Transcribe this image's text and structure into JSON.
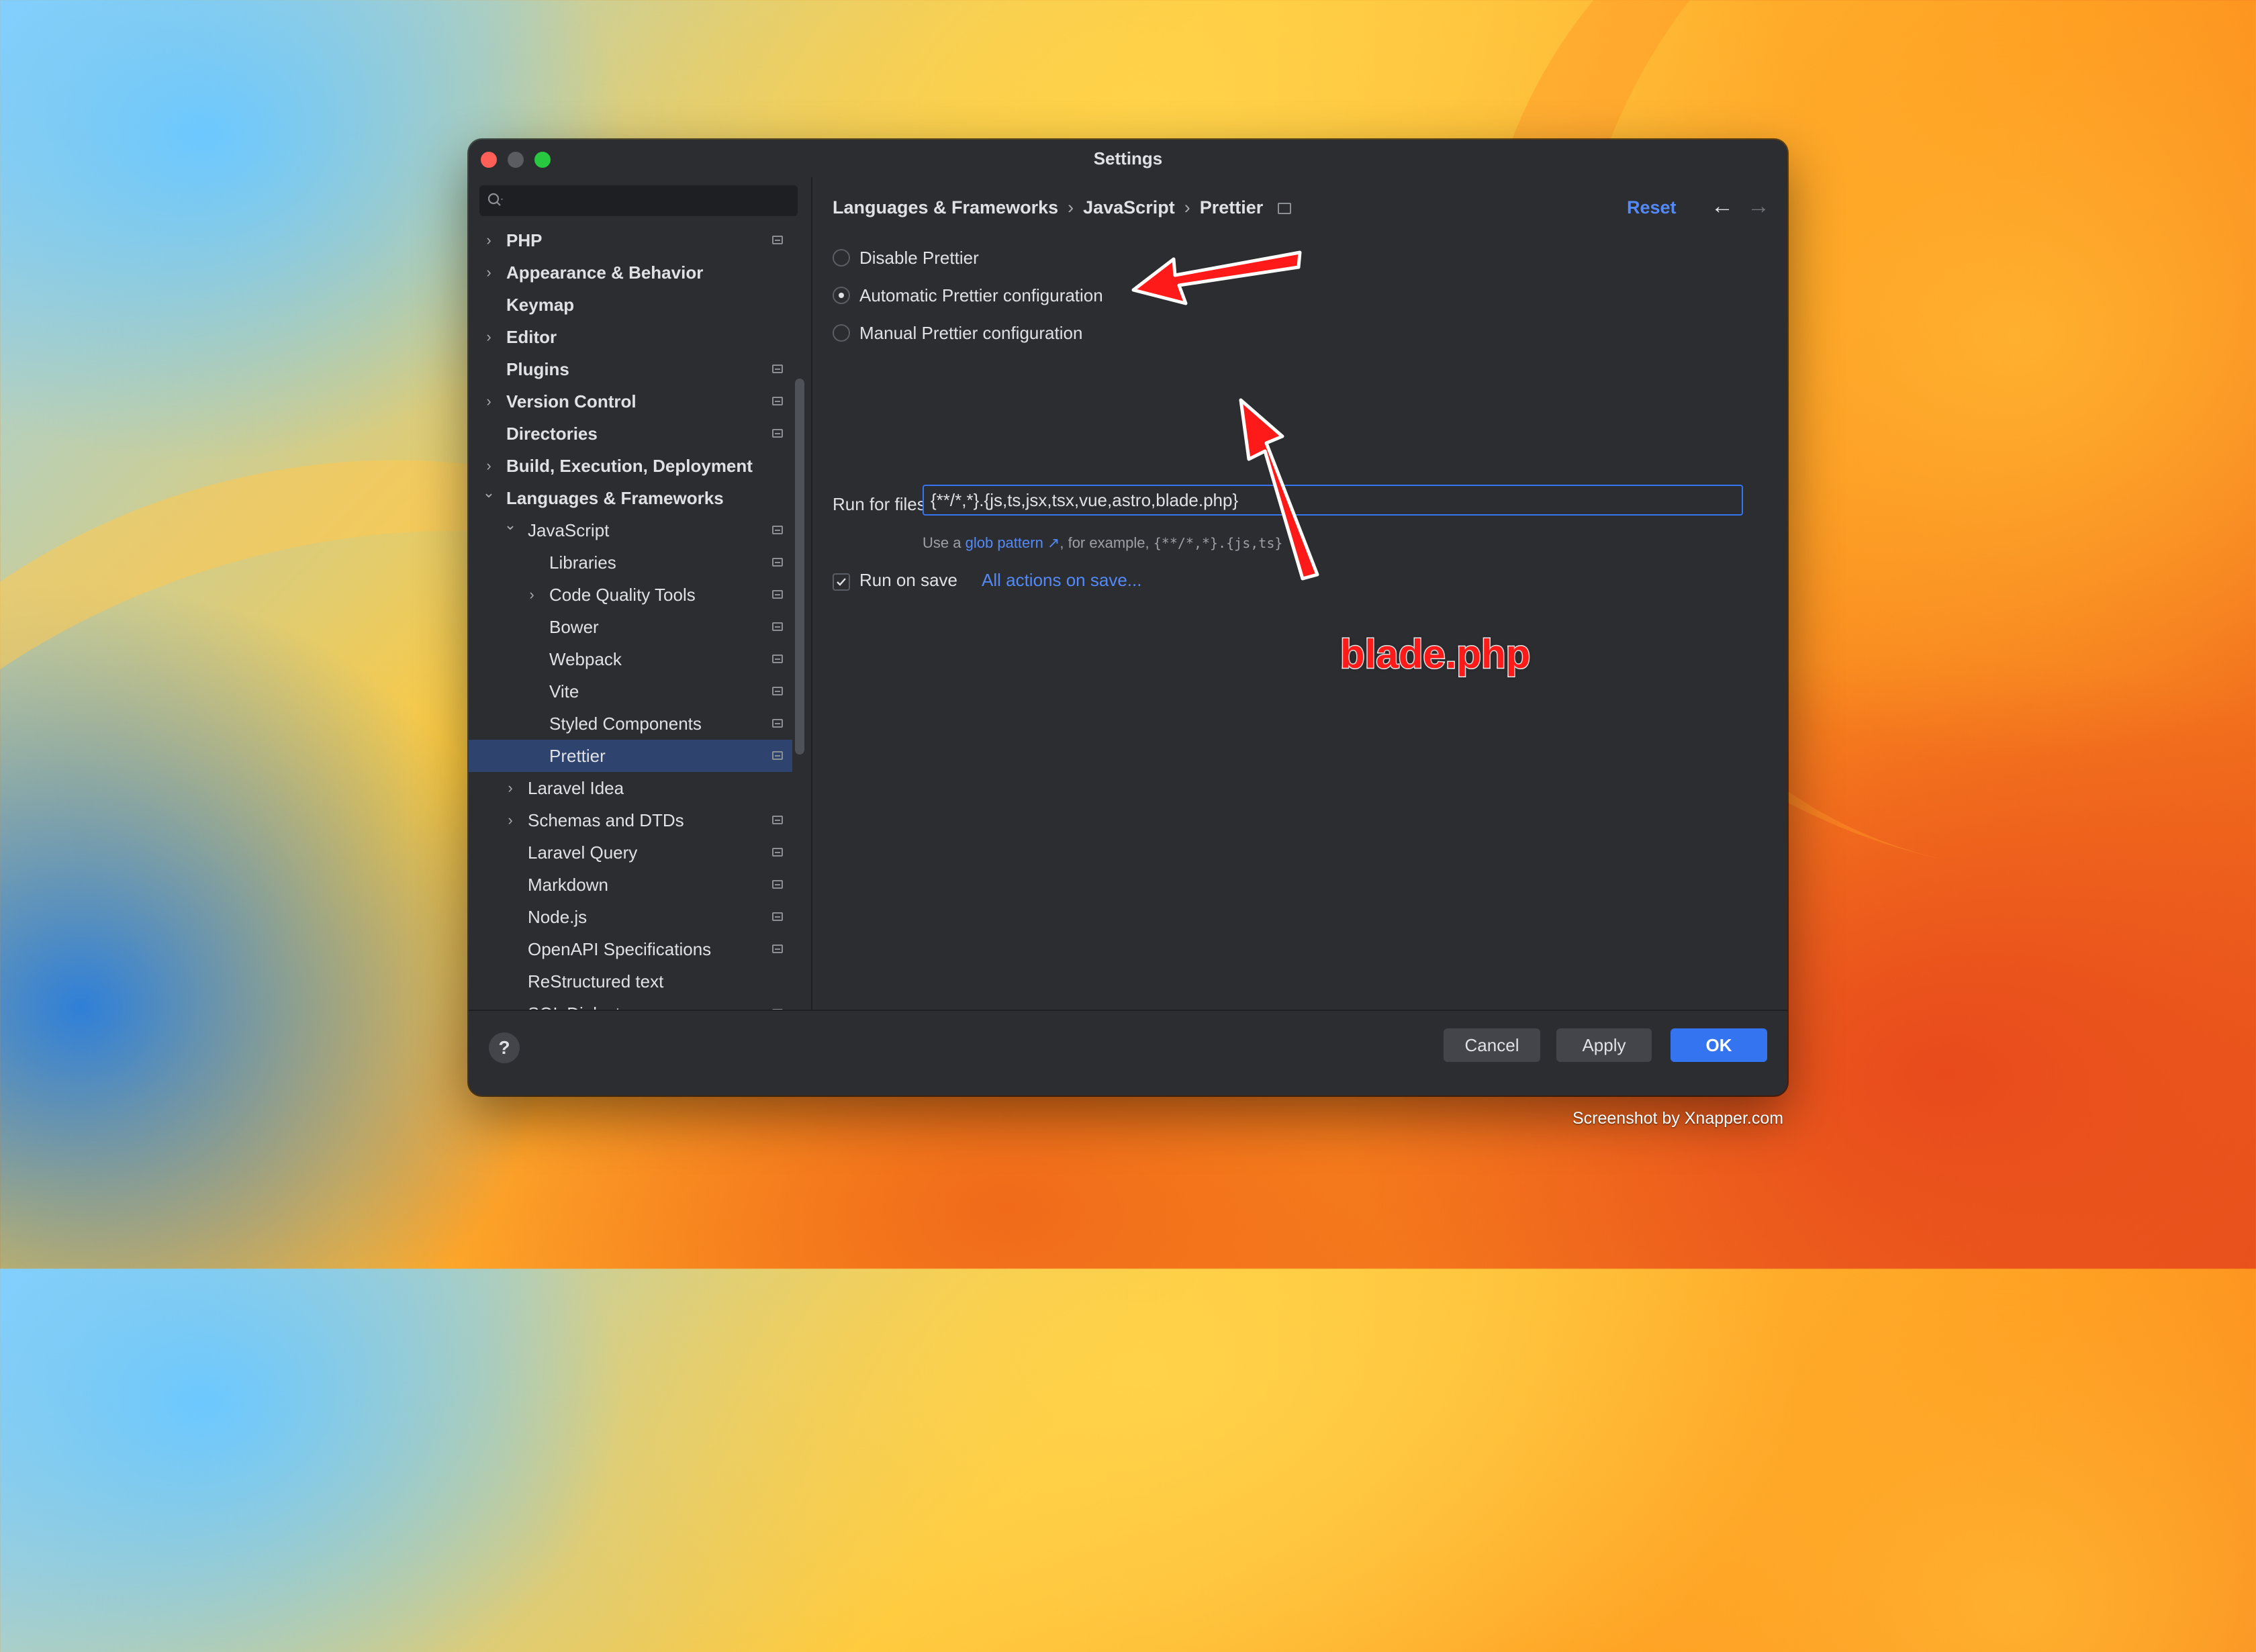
{
  "window": {
    "title": "Settings"
  },
  "sidebar": {
    "search_placeholder": "",
    "items": [
      {
        "label": "PHP",
        "level": 0,
        "expander": "collapsed",
        "badge": true,
        "bold": true
      },
      {
        "label": "Appearance & Behavior",
        "level": 0,
        "expander": "collapsed",
        "badge": false,
        "bold": true
      },
      {
        "label": "Keymap",
        "level": 0,
        "expander": "none",
        "badge": false,
        "bold": true
      },
      {
        "label": "Editor",
        "level": 0,
        "expander": "collapsed",
        "badge": false,
        "bold": true
      },
      {
        "label": "Plugins",
        "level": 0,
        "expander": "none",
        "badge": true,
        "bold": true
      },
      {
        "label": "Version Control",
        "level": 0,
        "expander": "collapsed",
        "badge": true,
        "bold": true
      },
      {
        "label": "Directories",
        "level": 0,
        "expander": "none",
        "badge": true,
        "bold": true
      },
      {
        "label": "Build, Execution, Deployment",
        "level": 0,
        "expander": "collapsed",
        "badge": false,
        "bold": true
      },
      {
        "label": "Languages & Frameworks",
        "level": 0,
        "expander": "expanded",
        "badge": false,
        "bold": true
      },
      {
        "label": "JavaScript",
        "level": 1,
        "expander": "expanded",
        "badge": true,
        "bold": false
      },
      {
        "label": "Libraries",
        "level": 2,
        "expander": "none",
        "badge": true,
        "bold": false
      },
      {
        "label": "Code Quality Tools",
        "level": 2,
        "expander": "collapsed",
        "badge": true,
        "bold": false
      },
      {
        "label": "Bower",
        "level": 2,
        "expander": "none",
        "badge": true,
        "bold": false
      },
      {
        "label": "Webpack",
        "level": 2,
        "expander": "none",
        "badge": true,
        "bold": false
      },
      {
        "label": "Vite",
        "level": 2,
        "expander": "none",
        "badge": true,
        "bold": false
      },
      {
        "label": "Styled Components",
        "level": 2,
        "expander": "none",
        "badge": true,
        "bold": false
      },
      {
        "label": "Prettier",
        "level": 2,
        "expander": "none",
        "badge": true,
        "bold": false,
        "selected": true
      },
      {
        "label": "Laravel Idea",
        "level": 1,
        "expander": "collapsed",
        "badge": false,
        "bold": false
      },
      {
        "label": "Schemas and DTDs",
        "level": 1,
        "expander": "collapsed",
        "badge": true,
        "bold": false
      },
      {
        "label": "Laravel Query",
        "level": 1,
        "expander": "none",
        "badge": true,
        "bold": false
      },
      {
        "label": "Markdown",
        "level": 1,
        "expander": "none",
        "badge": true,
        "bold": false
      },
      {
        "label": "Node.js",
        "level": 1,
        "expander": "none",
        "badge": true,
        "bold": false
      },
      {
        "label": "OpenAPI Specifications",
        "level": 1,
        "expander": "none",
        "badge": true,
        "bold": false
      },
      {
        "label": "ReStructured text",
        "level": 1,
        "expander": "none",
        "badge": false,
        "bold": false
      },
      {
        "label": "SQL Dialects",
        "level": 1,
        "expander": "none",
        "badge": true,
        "bold": false
      }
    ]
  },
  "breadcrumb": {
    "part1": "Languages & Frameworks",
    "part2": "JavaScript",
    "part3": "Prettier",
    "separator": "›"
  },
  "header": {
    "reset_label": "Reset",
    "back_icon": "←",
    "forward_icon": "→"
  },
  "options": {
    "disable_label": "Disable Prettier",
    "automatic_label": "Automatic Prettier configuration",
    "manual_label": "Manual Prettier configuration",
    "selected": "automatic"
  },
  "run_for_files": {
    "label": "Run for files:",
    "value": "{**/*,*}.{js,ts,jsx,tsx,vue,astro,blade.php}",
    "hint_prefix": "Use a",
    "hint_link": "glob pattern ↗",
    "hint_middle": ", for example,",
    "hint_example": "{**/*,*}.{js,ts}"
  },
  "run_on_save": {
    "label": "Run on save",
    "checked": true,
    "link": "All actions on save..."
  },
  "footer": {
    "help_label": "?",
    "cancel_label": "Cancel",
    "apply_label": "Apply",
    "ok_label": "OK"
  },
  "annotation": {
    "text": "blade.php",
    "color": "#ff1a1a"
  },
  "watermark": "Screenshot by Xnapper.com",
  "colors": {
    "accent": "#3574f0",
    "link": "#548af7",
    "selection": "#2e436e",
    "window_bg": "#2b2d30"
  }
}
